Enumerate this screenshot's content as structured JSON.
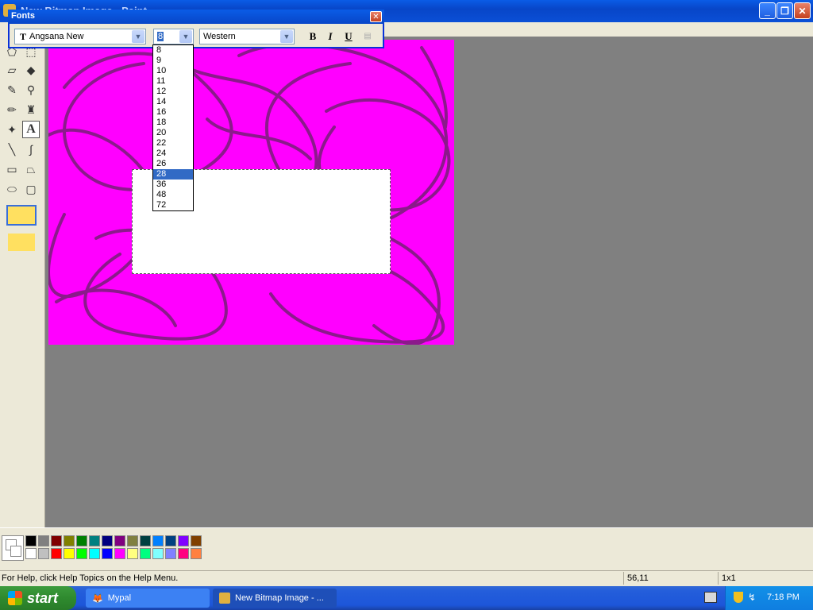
{
  "window": {
    "title": "New Bitmap Image - Paint"
  },
  "fonts_toolbar": {
    "title": "Fonts",
    "font_name": "Angsana New",
    "font_size": "8",
    "script": "Western",
    "bold_label": "B",
    "italic_label": "I",
    "underline_label": "U"
  },
  "size_list": [
    "8",
    "9",
    "10",
    "11",
    "12",
    "14",
    "16",
    "18",
    "20",
    "22",
    "24",
    "26",
    "28",
    "36",
    "48",
    "72"
  ],
  "size_selected": "28",
  "status": {
    "help": "For Help, click Help Topics on the Help Menu.",
    "coords": "56,11",
    "size": "1x1"
  },
  "taskbar": {
    "start": "start",
    "tasks": [
      {
        "label": "Mypal"
      },
      {
        "label": "New Bitmap Image - ..."
      }
    ],
    "time": "7:18 PM"
  },
  "palette": {
    "row1": [
      "#000000",
      "#808080",
      "#800000",
      "#808000",
      "#008000",
      "#008080",
      "#000080",
      "#800080",
      "#808040",
      "#004040",
      "#0080ff",
      "#004080",
      "#8000ff",
      "#804000"
    ],
    "row2": [
      "#ffffff",
      "#c0c0c0",
      "#ff0000",
      "#ffff00",
      "#00ff00",
      "#00ffff",
      "#0000ff",
      "#ff00ff",
      "#ffff80",
      "#00ff80",
      "#80ffff",
      "#8080ff",
      "#ff0080",
      "#ff8040"
    ]
  },
  "colors": {
    "canvas": "#ff00ff",
    "scribble": "#8b1a8b",
    "workspace": "#808080"
  }
}
